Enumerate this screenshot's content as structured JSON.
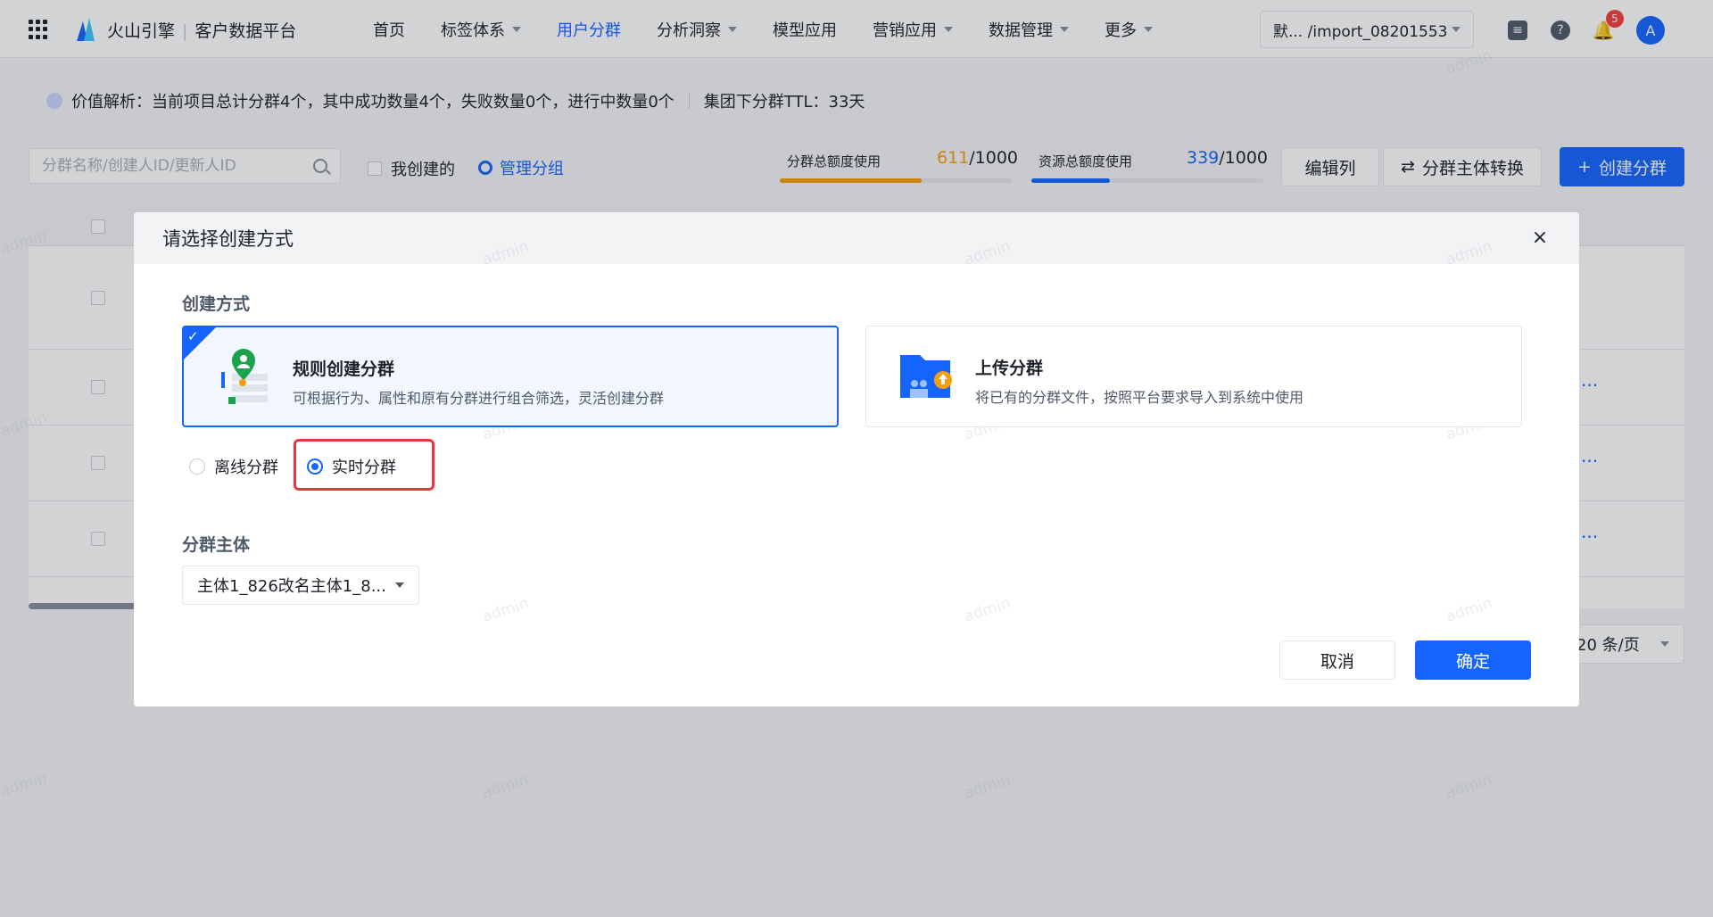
{
  "brand": {
    "name": "火山引擎",
    "product": "客户数据平台"
  },
  "nav": [
    {
      "label": "首页",
      "dropdown": false,
      "active": false
    },
    {
      "label": "标签体系",
      "dropdown": true,
      "active": false
    },
    {
      "label": "用户分群",
      "dropdown": false,
      "active": true
    },
    {
      "label": "分析洞察",
      "dropdown": true,
      "active": false
    },
    {
      "label": "模型应用",
      "dropdown": false,
      "active": false
    },
    {
      "label": "营销应用",
      "dropdown": true,
      "active": false
    },
    {
      "label": "数据管理",
      "dropdown": true,
      "active": false
    },
    {
      "label": "更多",
      "dropdown": true,
      "active": false
    }
  ],
  "project_select": "默... /import_08201553",
  "notifications_count": "5",
  "avatar_letter": "A",
  "info_bar": {
    "value_text": "价值解析：当前项目总计分群4个，其中成功数量4个，失败数量0个，进行中数量0个",
    "ttl_text": "集团下分群TTL：33天"
  },
  "toolbar": {
    "search_placeholder": "分群名称/创建人ID/更新人ID",
    "mine_label": "我创建的",
    "manage_label": "管理分组",
    "segment_quota_label": "分群总额度使用",
    "segment_quota_used": "611",
    "segment_quota_total": "/1000",
    "segment_quota_fraction": 0.611,
    "resource_quota_label": "资源总额度使用",
    "resource_quota_used": "339",
    "resource_quota_total": "/1000",
    "resource_quota_fraction": 0.339,
    "edit_columns_label": "编辑列",
    "convert_label": "分群主体转换",
    "create_label": "创建分群"
  },
  "pager": {
    "page_size": "20 条/页"
  },
  "watermark": "admin",
  "modal": {
    "title": "请选择创建方式",
    "creation_section_label": "创建方式",
    "option_rule": {
      "title": "规则创建分群",
      "description": "可根据行为、属性和原有分群进行组合筛选，灵活创建分群",
      "selected": true
    },
    "option_upload": {
      "title": "上传分群",
      "description": "将已有的分群文件，按照平台要求导入到系统中使用",
      "selected": false
    },
    "radio_offline": "离线分群",
    "radio_realtime": "实时分群",
    "radio_selected": "实时分群",
    "subject_section_label": "分群主体",
    "subject_value": "主体1_826改名主体1_8...",
    "cancel_label": "取消",
    "ok_label": "确定"
  },
  "colors": {
    "primary": "#1664ff",
    "highlight": "#e8363c",
    "quota_orange": "#f59e0b",
    "quota_blue": "#1664ff"
  }
}
